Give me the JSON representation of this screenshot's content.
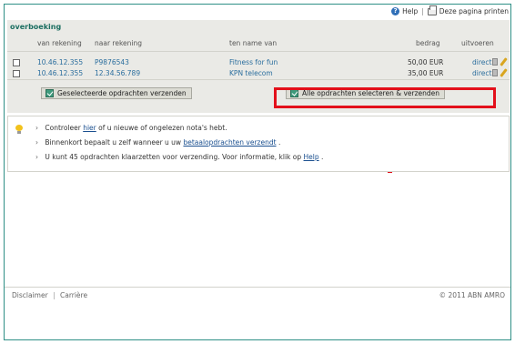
{
  "topbar": {
    "help_label": "Help",
    "separator": "|",
    "print_label": "Deze pagina printen"
  },
  "section": {
    "title": "overboeking"
  },
  "table": {
    "headers": [
      "van rekening",
      "naar rekening",
      "ten name van",
      "bedrag",
      "uitvoeren"
    ],
    "rows": [
      {
        "from": "10.46.12.355",
        "to": "P9876543",
        "name": "Fitness for fun",
        "amount": "50,00 EUR",
        "status": "direct"
      },
      {
        "from": "10.46.12.355",
        "to": "12.34.56.789",
        "name": "KPN telecom",
        "amount": "35,00 EUR",
        "status": "direct"
      }
    ]
  },
  "buttons": {
    "send_selected": "Geselecteerde opdrachten verzenden",
    "select_all_send": "Alle opdrachten selecteren & verzenden"
  },
  "info": {
    "line1_prefix": "Controleer ",
    "line1_link": "hier",
    "line1_suffix": " of u nieuwe of ongelezen nota's hebt.",
    "line2_prefix": "Binnenkort bepaalt u zelf wanneer u uw ",
    "line2_link": "betaalopdrachten verzendt",
    "line2_suffix": ".",
    "line3_prefix": "U kunt 45 opdrachten klaarzetten voor verzending. Voor informatie, klik op ",
    "line3_link": "Help",
    "line3_suffix": "."
  },
  "footer": {
    "disclaimer": "Disclaimer",
    "separator": "|",
    "careers": "Carrière",
    "copyright": "© 2011 ABN AMRO"
  },
  "colors": {
    "accent_red": "#e3101b",
    "section_green": "#1d6f62",
    "link_blue": "#2b6e9e"
  }
}
